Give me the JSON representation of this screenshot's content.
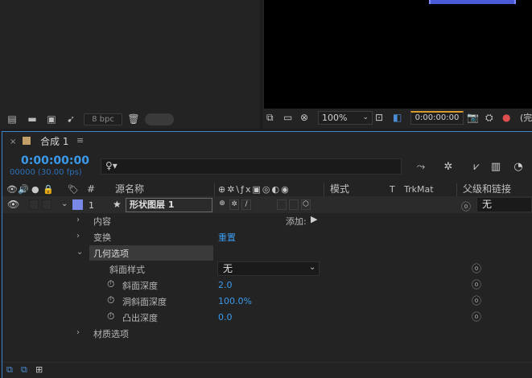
{
  "project_panel": {
    "bpc_label": "8 bpc"
  },
  "viewer": {
    "zoom": "100%",
    "timecode": "0:00:00:00",
    "more_label": "(完"
  },
  "timeline": {
    "tab": {
      "close": "×",
      "title": "合成 1",
      "menu": "≡"
    },
    "timecode": "0:00:00:00",
    "frames": "00000 (30.00 fps)",
    "search": {
      "icon": "♀▾"
    },
    "columns": {
      "hash": "#",
      "source_name": "源名称",
      "mode": "模式",
      "t": "T",
      "trkmat": "TrkMat",
      "parent": "父级和链接"
    },
    "layer": {
      "number": "1",
      "name": "形状图层 1",
      "parent_value": "无"
    },
    "properties": {
      "contents": "内容",
      "add_label": "添加:",
      "transform": "变换",
      "reset": "重置",
      "geometry": "几何选项",
      "bevel_style": "斜面样式",
      "bevel_style_value": "无",
      "bevel_depth": "斜面深度",
      "bevel_depth_value": "2.0",
      "hole_bevel_depth": "洞斜面深度",
      "hole_bevel_depth_value": "100.0%",
      "extrusion_depth": "凸出深度",
      "extrusion_depth_value": "0.0",
      "material": "材质选项"
    }
  },
  "colors": {
    "accent_blue": "#3b9aeb",
    "label_swatch": "#7a88e8",
    "comp_swatch": "#c2a067",
    "time_marker": "#d79a2b"
  }
}
